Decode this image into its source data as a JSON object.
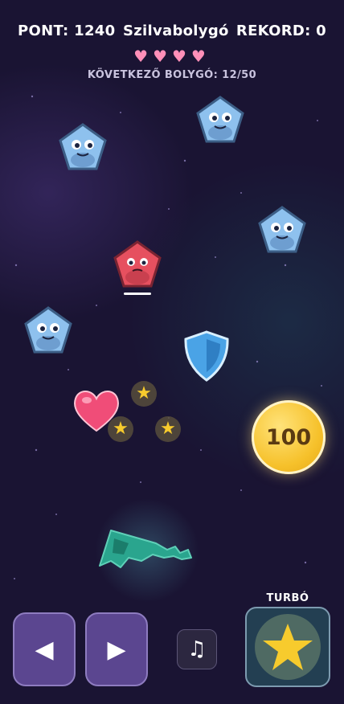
{
  "hud": {
    "score_label": "PONT: 1240",
    "planet_name": "Szilvabolygó",
    "record_label": "REKORD: 0",
    "lives": "♥♥♥♥",
    "next_planet": "KÖVETKEZŐ BOLYGÓ: 12/50"
  },
  "pickups": {
    "coin_value": "100"
  },
  "controls": {
    "left_arrow": "◀",
    "right_arrow": "▶",
    "music_icon": "♫",
    "turbo_label": "TURBÓ"
  },
  "colors": {
    "background": "#1a1433",
    "enemy_blue": "#8ec1ee",
    "enemy_red": "#e6505f",
    "heart_pink": "#ff8fb8",
    "coin_gold": "#f6c12b",
    "button_purple": "#5b4690",
    "turbo_teal": "#233f52"
  }
}
